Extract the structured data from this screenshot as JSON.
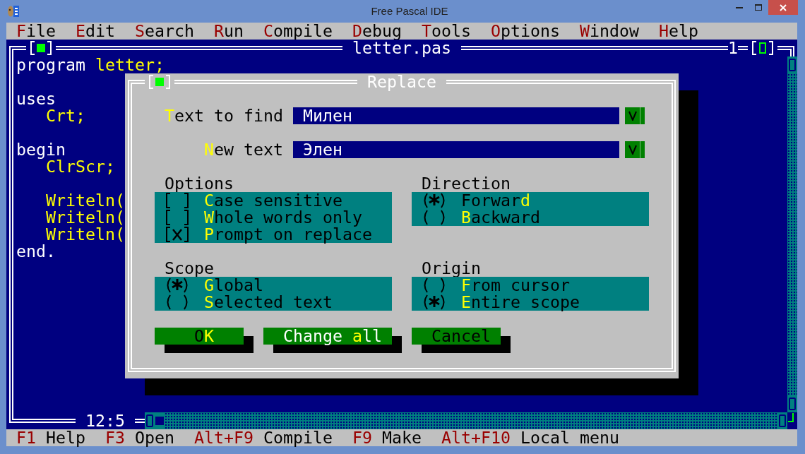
{
  "window": {
    "title": "Free Pascal IDE"
  },
  "menu": [
    {
      "key": "F",
      "post": "ile"
    },
    {
      "key": "E",
      "post": "dit"
    },
    {
      "key": "S",
      "post": "earch"
    },
    {
      "key": "R",
      "post": "un"
    },
    {
      "key": "C",
      "post": "ompile"
    },
    {
      "key": "D",
      "post": "ebug"
    },
    {
      "key": "T",
      "post": "ools"
    },
    {
      "key": "O",
      "post": "ptions"
    },
    {
      "key": "W",
      "post": "indow"
    },
    {
      "key": "H",
      "post": "elp"
    }
  ],
  "editor": {
    "title": "letter.pas",
    "number": "1",
    "blocks": [
      [
        {
          "tokens": [
            {
              "text": "program",
              "kind": "keyword"
            },
            {
              "text": "letter;",
              "kind": "identifier"
            }
          ]
        }
      ],
      [
        {
          "tokens": [
            {
              "text": "uses",
              "kind": "keyword"
            }
          ]
        },
        {
          "children": [
            {
              "tokens": [
                {
                  "text": "Crt;",
                  "kind": "identifier"
                }
              ]
            }
          ]
        }
      ],
      [
        {
          "tokens": [
            {
              "text": "begin",
              "kind": "keyword"
            }
          ]
        },
        {
          "children": [
            {
              "tokens": [
                {
                  "text": "ClrScr;",
                  "kind": "identifier"
                }
              ]
            }
          ]
        }
      ],
      [
        {
          "children": [
            {
              "tokens": [
                {
                  "text": "Writeln(",
                  "kind": "identifier"
                }
              ]
            },
            {
              "tokens": [
                {
                  "text": "Writeln(",
                  "kind": "identifier"
                }
              ]
            },
            {
              "tokens": [
                {
                  "text": "Writeln(",
                  "kind": "identifier"
                }
              ]
            }
          ]
        },
        {
          "tokens": [
            {
              "text": "end.",
              "kind": "keyword"
            }
          ]
        }
      ]
    ],
    "cursor": "12:5"
  },
  "dialog": {
    "title": "Replace",
    "fields": [
      {
        "label": {
          "key": "T",
          "post": "ext to find"
        },
        "value": "Милен"
      },
      {
        "label": {
          "key": "N",
          "post": "ew text"
        },
        "value": "Элен"
      }
    ],
    "groups": [
      {
        "title": "Options",
        "kind": "checkbox",
        "items": [
          {
            "label": {
              "key": "C",
              "post": "ase sensitive"
            },
            "checked": false
          },
          {
            "label": {
              "key": "W",
              "post": "hole words only"
            },
            "checked": false
          },
          {
            "label": {
              "key": "P",
              "post": "rompt on replace"
            },
            "checked": true
          }
        ]
      },
      {
        "title": "Direction",
        "kind": "radio",
        "items": [
          {
            "label": {
              "pre": "Forwar",
              "key": "d"
            },
            "selected": true
          },
          {
            "label": {
              "key": "B",
              "post": "ackward"
            },
            "selected": false
          }
        ]
      },
      {
        "title": "Scope",
        "kind": "radio",
        "items": [
          {
            "label": {
              "key": "G",
              "post": "lobal"
            },
            "selected": true
          },
          {
            "label": {
              "key": "S",
              "post": "elected text"
            },
            "selected": false
          }
        ]
      },
      {
        "title": "Origin",
        "kind": "radio",
        "items": [
          {
            "label": {
              "key": "F",
              "post": "rom cursor"
            },
            "selected": false
          },
          {
            "label": {
              "key": "E",
              "post": "ntire scope"
            },
            "selected": true
          }
        ]
      }
    ],
    "buttons": [
      {
        "label": {
          "pre": "O",
          "key": "K"
        },
        "default": false
      },
      {
        "label": {
          "pre": "Change ",
          "key": "a",
          "post": "ll"
        },
        "default": true
      },
      {
        "label": {
          "pre": "Cancel"
        },
        "default": false
      }
    ]
  },
  "status_bar": [
    {
      "key": "F1",
      "label": "Help"
    },
    {
      "key": "F3",
      "label": "Open"
    },
    {
      "key": "Alt+F9",
      "label": "Compile"
    },
    {
      "key": "F9",
      "label": "Make"
    },
    {
      "key": "Alt+F10",
      "label": "Local menu"
    }
  ]
}
